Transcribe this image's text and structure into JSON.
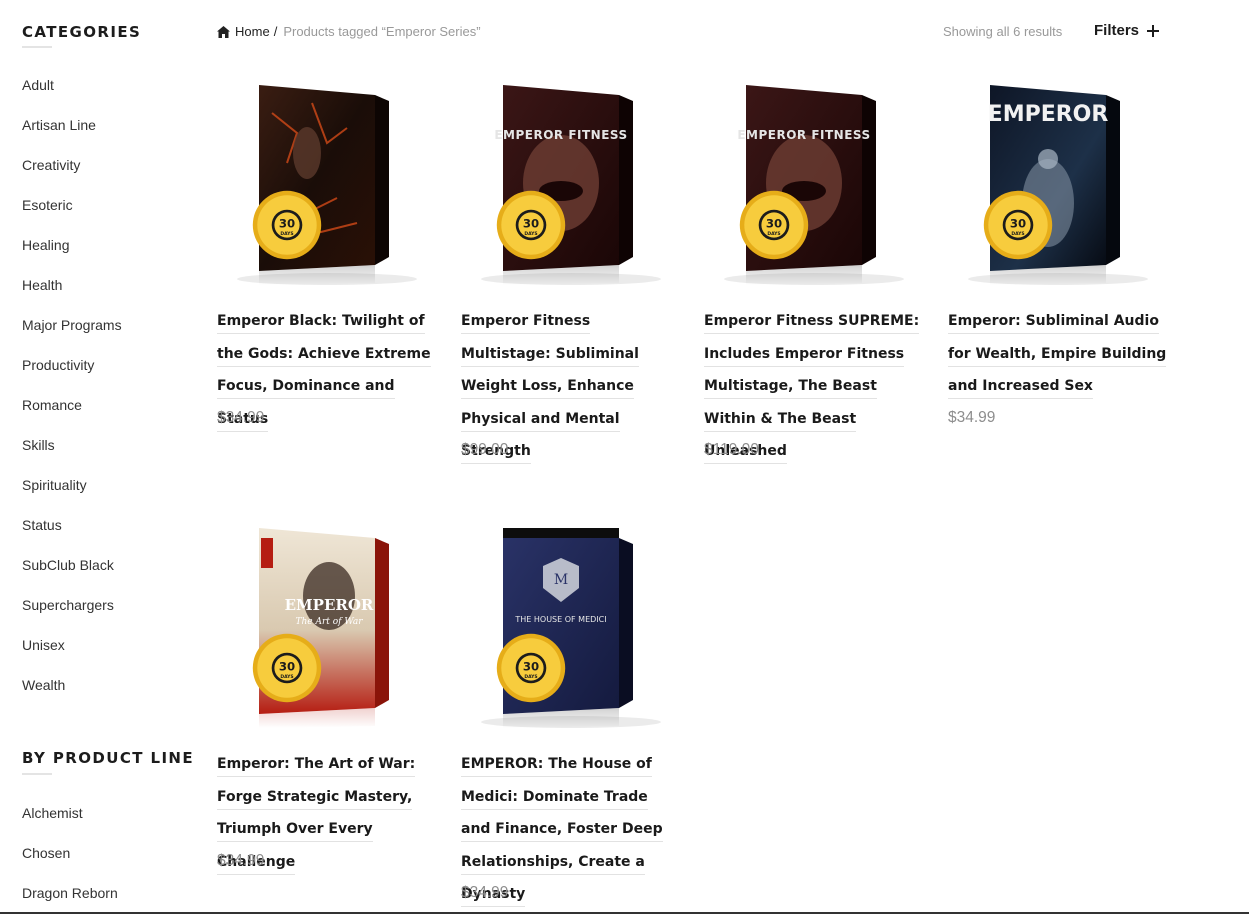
{
  "sidebar": {
    "categories_title": "CATEGORIES",
    "categories": [
      "Adult",
      "Artisan Line",
      "Creativity",
      "Esoteric",
      "Healing",
      "Health",
      "Major Programs",
      "Productivity",
      "Romance",
      "Skills",
      "Spirituality",
      "Status",
      "SubClub Black",
      "Superchargers",
      "Unisex",
      "Wealth"
    ],
    "product_line_title": "BY PRODUCT LINE",
    "product_lines": [
      "Alchemist",
      "Chosen",
      "Dragon Reborn"
    ]
  },
  "breadcrumb": {
    "home": "Home",
    "separator": "/",
    "current": "Products tagged “Emperor Series”"
  },
  "result_count": "Showing all 6 results",
  "filters_label": "Filters",
  "badge": {
    "line1": "100% MONEY BACK",
    "number": "30",
    "days": "DAYS",
    "line2": "GUARANTEE"
  },
  "products": [
    {
      "title": "Emperor Black: Twilight of the Gods: Achieve Extreme Focus, Dominance and Status",
      "price": "$34.99",
      "box_label": ""
    },
    {
      "title": "Emperor Fitness Multistage: Subliminal Weight Loss, Enhance Physical and Mental Strength",
      "price": "$99.00",
      "box_label": "EMPEROR FITNESS"
    },
    {
      "title": "Emperor Fitness SUPREME: Includes Emperor Fitness Multistage, The Beast Within & The Beast Unleashed",
      "price": "$119.00",
      "box_label": "EMPEROR FITNESS"
    },
    {
      "title": "Emperor: Subliminal Audio for Wealth, Empire Building and Increased Sex",
      "price": "$34.99",
      "box_label": "EMPEROR"
    },
    {
      "title": "Emperor: The Art of War: Forge Strategic Mastery, Triumph Over Every Challenge",
      "price": "$34.99",
      "box_label": "EMPEROR",
      "box_sublabel": "The Art of War"
    },
    {
      "title": "EMPEROR: The House of Medici: Dominate Trade and Finance, Foster Deep Relationships, Create a Dynasty",
      "price": "$34.99",
      "box_label": "THE HOUSE OF MEDICI",
      "box_sublabel": "M"
    }
  ],
  "colors": {
    "badge_gold": "#f2c12e",
    "text_dark": "#1a1a1a",
    "price": "#8d8d8d"
  }
}
